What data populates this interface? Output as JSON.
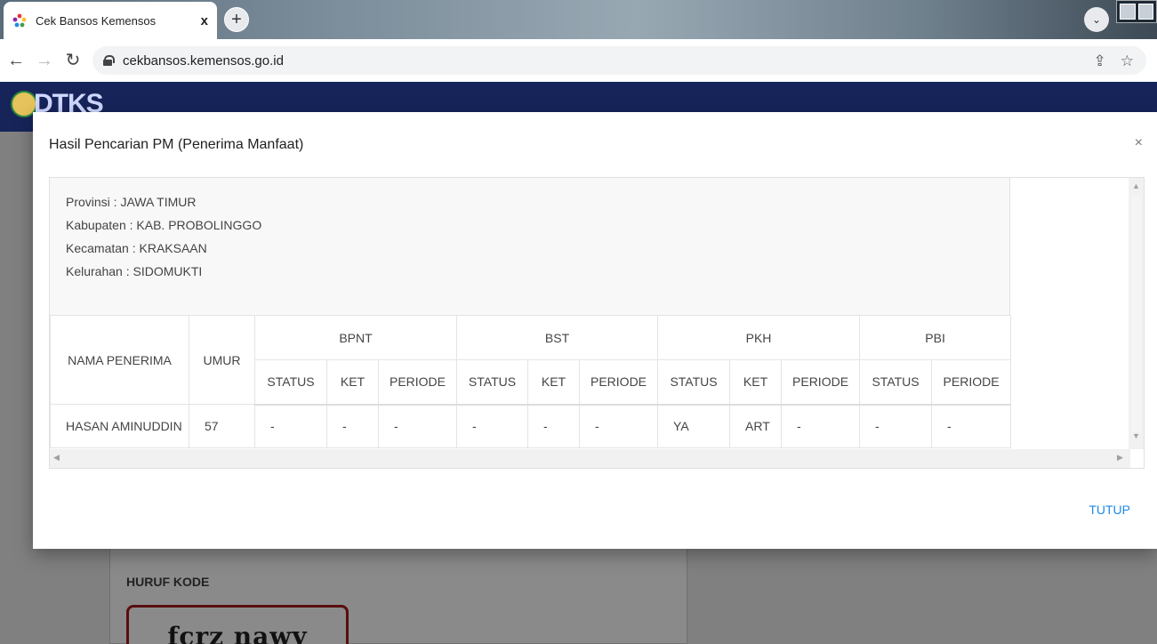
{
  "browser": {
    "tab_title": "Cek Bansos Kemensos",
    "tab_close": "x",
    "new_tab": "+",
    "tab_search": "⌄",
    "url": "cekbansos.kemensos.go.id"
  },
  "site": {
    "logo_text": "DTKS",
    "captcha_label": "HURUF KODE",
    "captcha_text": "fcrz nawy"
  },
  "modal": {
    "title": "Hasil Pencarian PM (Penerima Manfaat)",
    "close": "×",
    "info": [
      "Provinsi : JAWA TIMUR",
      "Kabupaten : KAB. PROBOLINGGO",
      "Kecamatan : KRAKSAAN",
      "Kelurahan : SIDOMUKTI"
    ],
    "table": {
      "headers": {
        "nama": "NAMA PENERIMA",
        "umur": "UMUR",
        "groups": [
          "BPNT",
          "BST",
          "PKH",
          "PBI"
        ],
        "sub": [
          "STATUS",
          "KET",
          "PERIODE",
          "STATUS",
          "KET",
          "PERIODE",
          "STATUS",
          "KET",
          "PERIODE",
          "STATUS",
          "PERIODE"
        ]
      },
      "row": {
        "nama": "HASAN AMINUDDIN",
        "umur": "57",
        "values": [
          "-",
          "-",
          "-",
          "-",
          "-",
          "-",
          "YA",
          "ART",
          "-",
          "-",
          "-"
        ]
      }
    },
    "close_button": "TUTUP"
  }
}
